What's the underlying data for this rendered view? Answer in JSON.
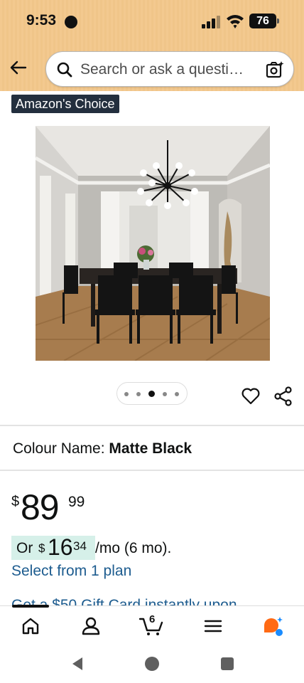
{
  "status_bar": {
    "time": "9:53",
    "battery": "76"
  },
  "header": {
    "search_placeholder": "Search or ask a questi…",
    "icons": [
      "back-arrow-icon",
      "search-icon",
      "camera-lens-icon"
    ]
  },
  "product": {
    "badge": "Amazon's Choice",
    "image_alt": "Sputnik chandelier above dark dining table",
    "carousel": {
      "count": 5,
      "active_index": 2
    }
  },
  "colour": {
    "label": "Colour Name:",
    "value": "Matte Black"
  },
  "price": {
    "symbol": "$",
    "whole": "89",
    "fraction": "99"
  },
  "monthly": {
    "prefix": "Or",
    "symbol": "$",
    "whole": "16",
    "fraction": "34",
    "suffix": "/mo (6 mo)."
  },
  "plan_link": "Select from 1 plan",
  "gift_card": "Get a $50 Gift Card instantly upon",
  "bottom_nav": {
    "cart_count": "6",
    "items": [
      "home-icon",
      "account-icon",
      "cart-icon",
      "menu-icon",
      "ai-assistant-icon"
    ]
  },
  "colors": {
    "header_bg": "#f3c98f",
    "link": "#1d5c8f",
    "badge_bg": "#232f3e",
    "emi_chip": "#d6f0e9",
    "assistant_orange": "#ff6a14",
    "assistant_blue": "#1a8cff"
  }
}
